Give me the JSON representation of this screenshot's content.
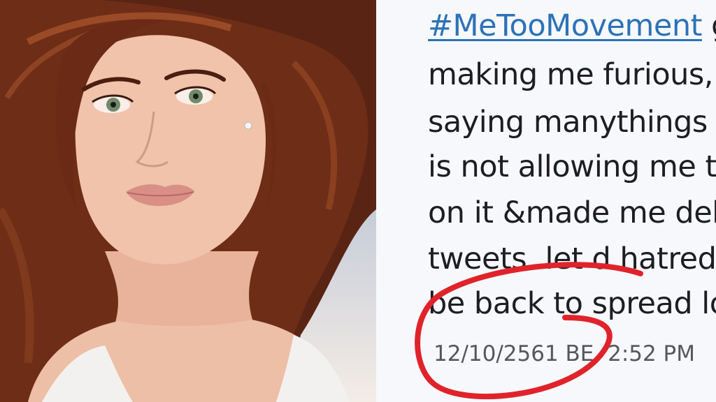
{
  "photo": {
    "subject": "portrait-of-woman"
  },
  "tweet": {
    "hashtag": "#MeTooMovement",
    "line1_rest": " g",
    "lines": [
      "making me furious,I’r",
      "saying manythings b",
      "is not allowing me to",
      "on it &made me delet",
      "tweets..let d hatred g",
      "be back to spread lov"
    ],
    "timestamp": "12/10/2561 BE, 2:52 PM"
  },
  "colors": {
    "hashtag": "#2c72b7",
    "tweet_text": "#1d1d22",
    "timestamp": "#55575e",
    "annotation": "#e0232b"
  }
}
